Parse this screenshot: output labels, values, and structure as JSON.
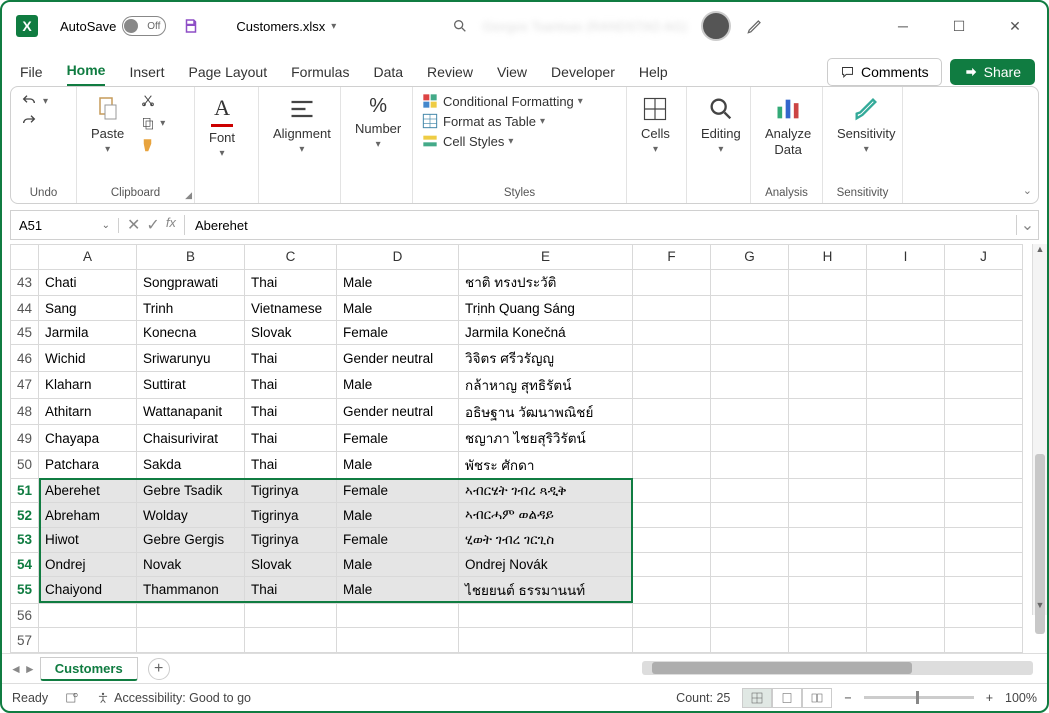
{
  "title": {
    "autosave": "AutoSave",
    "autosave_state": "Off",
    "filename": "Customers.xlsx",
    "blurred_text": "Giorgos Tsantsas (RANDSTAD AG)"
  },
  "menu": {
    "file": "File",
    "home": "Home",
    "insert": "Insert",
    "page_layout": "Page Layout",
    "formulas": "Formulas",
    "data": "Data",
    "review": "Review",
    "view": "View",
    "developer": "Developer",
    "help": "Help",
    "comments": "Comments",
    "share": "Share"
  },
  "ribbon": {
    "undo": "Undo",
    "clipboard": "Clipboard",
    "paste": "Paste",
    "font": "Font",
    "alignment": "Alignment",
    "number": "Number",
    "styles": "Styles",
    "cond_fmt": "Conditional Formatting",
    "fmt_table": "Format as Table",
    "cell_styles": "Cell Styles",
    "cells": "Cells",
    "editing": "Editing",
    "analyze": "Analyze Data",
    "analysis": "Analysis",
    "sensitivity": "Sensitivity",
    "sensitivity_grp": "Sensitivity"
  },
  "formula_bar": {
    "cell_ref": "A51",
    "value": "Aberehet"
  },
  "columns": [
    "A",
    "B",
    "C",
    "D",
    "E",
    "F",
    "G",
    "H",
    "I",
    "J"
  ],
  "rows": [
    {
      "n": 43,
      "c": [
        "Chati",
        "Songprawati",
        "Thai",
        "Male",
        "ชาติ ทรงประวัติ"
      ]
    },
    {
      "n": 44,
      "c": [
        "Sang",
        "Trinh",
        "Vietnamese",
        "Male",
        "Trịnh Quang Sáng"
      ]
    },
    {
      "n": 45,
      "c": [
        "Jarmila",
        "Konecna",
        "Slovak",
        "Female",
        "Jarmila Konečná"
      ]
    },
    {
      "n": 46,
      "c": [
        "Wichid",
        "Sriwarunyu",
        "Thai",
        "Gender neutral",
        "วิจิตร ศรีวรัญญู"
      ]
    },
    {
      "n": 47,
      "c": [
        "Klaharn",
        "Suttirat",
        "Thai",
        "Male",
        "กล้าหาญ สุทธิรัตน์"
      ]
    },
    {
      "n": 48,
      "c": [
        "Athitarn",
        "Wattanapanit",
        "Thai",
        "Gender neutral",
        "อธิษฐาน วัฒนาพณิชย์"
      ]
    },
    {
      "n": 49,
      "c": [
        "Chayapa",
        "Chaisurivirat",
        "Thai",
        "Female",
        "ชญาภา ไชยสุริวิรัตน์"
      ]
    },
    {
      "n": 50,
      "c": [
        "Patchara",
        "Sakda",
        "Thai",
        "Male",
        "พัชระ ศักดา"
      ]
    },
    {
      "n": 51,
      "c": [
        "Aberehet",
        "Gebre Tsadik",
        "Tigrinya",
        "Female",
        "ኣብርሄት ገብረ ጻዲቅ"
      ],
      "sel": true
    },
    {
      "n": 52,
      "c": [
        "Abreham",
        "Wolday",
        "Tigrinya",
        "Male",
        "ኣብርሓም ወልዳይ"
      ],
      "sel": true
    },
    {
      "n": 53,
      "c": [
        "Hiwot",
        "Gebre Gergis",
        "Tigrinya",
        "Female",
        "ሂወት ገብረ ገርጊስ"
      ],
      "sel": true
    },
    {
      "n": 54,
      "c": [
        "Ondrej",
        "Novak",
        "Slovak",
        "Male",
        "Ondrej Novák"
      ],
      "sel": true
    },
    {
      "n": 55,
      "c": [
        "Chaiyond",
        "Thammanon",
        "Thai",
        "Male",
        "ไชยยนต์ ธรรมานนท์"
      ],
      "sel": true
    },
    {
      "n": 56,
      "c": [
        "",
        "",
        "",
        "",
        ""
      ]
    },
    {
      "n": 57,
      "c": [
        "",
        "",
        "",
        "",
        ""
      ]
    }
  ],
  "sheet": {
    "name": "Customers"
  },
  "status": {
    "ready": "Ready",
    "accessibility": "Accessibility: Good to go",
    "count": "Count: 25",
    "zoom": "100%"
  }
}
